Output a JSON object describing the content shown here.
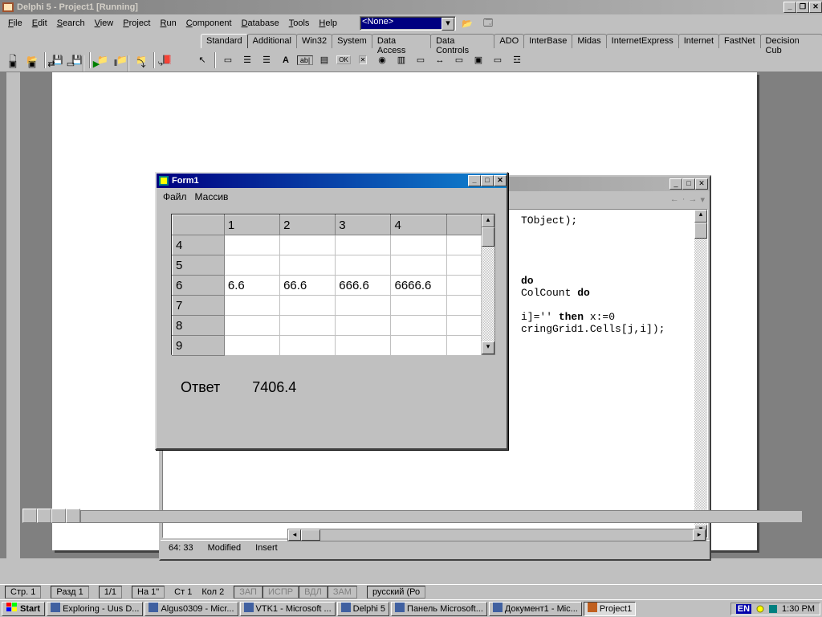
{
  "app_title": "Delphi 5 - Project1 [Running]",
  "main_menu": [
    "File",
    "Edit",
    "Search",
    "View",
    "Project",
    "Run",
    "Component",
    "Database",
    "Tools",
    "Help"
  ],
  "dropdown_value": "<None>",
  "palette_tabs": [
    "Standard",
    "Additional",
    "Win32",
    "System",
    "Data Access",
    "Data Controls",
    "ADO",
    "InterBase",
    "Midas",
    "InternetExpress",
    "Internet",
    "FastNet",
    "Decision Cub"
  ],
  "palette_active": "Standard",
  "code_window": {
    "lines": [
      "TObject);",
      "",
      "",
      "",
      "",
      " do",
      "ColCount do",
      "",
      "i]='' then x:=0",
      "cringGrid1.Cells[j,i]);"
    ],
    "status_pos": "64: 33",
    "status_modified": "Modified",
    "status_ins": "Insert"
  },
  "form_window": {
    "title": "Form1",
    "menu": [
      "Файл",
      "Массив"
    ],
    "col_headers": [
      "1",
      "2",
      "3",
      "4"
    ],
    "row_headers": [
      "4",
      "5",
      "6",
      "7",
      "8",
      "9"
    ],
    "data_row_index": 2,
    "data_row": [
      "6.6",
      "66.6",
      "666.6",
      "6666.6"
    ],
    "answer_label": "Ответ",
    "answer_value": "7406.4"
  },
  "word_status": {
    "page": "Стр. 1",
    "section": "Разд 1",
    "pages": "1/1",
    "at": "На 1\"",
    "line": "Ст 1",
    "col": "Кол 2",
    "flags": [
      "ЗАП",
      "ИСПР",
      "ВДЛ",
      "ЗАМ"
    ],
    "lang": "русский (Ро"
  },
  "taskbar": {
    "start": "Start",
    "buttons": [
      {
        "label": "Exploring - Uus D..."
      },
      {
        "label": "Algus0309 - Micr..."
      },
      {
        "label": "VTK1 - Microsoft ..."
      },
      {
        "label": "Delphi 5"
      },
      {
        "label": "Панель Microsoft..."
      },
      {
        "label": "Документ1 - Mic..."
      },
      {
        "label": "Project1",
        "active": true
      }
    ],
    "lang_ind": "EN",
    "time": "1:30 PM"
  }
}
